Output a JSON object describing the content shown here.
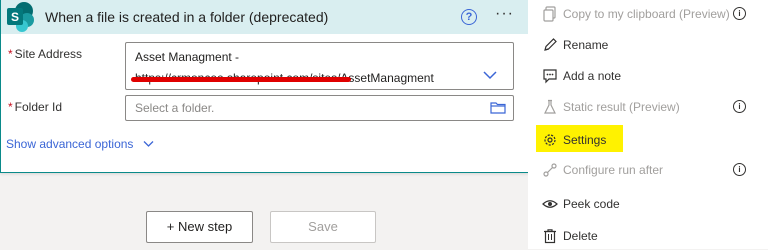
{
  "card": {
    "title": "When a file is created in a folder (deprecated)",
    "help_glyph": "?",
    "more_glyph": "···",
    "site_label": "Site Address",
    "required_mark": "*",
    "site_value_line1": "Asset Managment -",
    "site_value_line2": "https://crmoncee.sharepoint.com/sites/AssetManagment",
    "folder_label": "Folder Id",
    "folder_placeholder": "Select a folder.",
    "advanced_link": "Show advanced options",
    "logo_letter": "S"
  },
  "buttons": {
    "new_step": "+ New step",
    "save": "Save"
  },
  "menu": {
    "items": [
      {
        "label": "Copy to my clipboard (Preview)",
        "icon": "copy-icon",
        "disabled": true,
        "info": true
      },
      {
        "label": "Rename",
        "icon": "pencil-icon",
        "disabled": false,
        "info": false
      },
      {
        "label": "Add a note",
        "icon": "note-icon",
        "disabled": false,
        "info": false
      },
      {
        "label": "Static result (Preview)",
        "icon": "flask-icon",
        "disabled": true,
        "info": true
      },
      {
        "label": "Settings",
        "icon": "gear-icon",
        "disabled": false,
        "info": false,
        "highlighted": true
      },
      {
        "label": "Configure run after",
        "icon": "run-after-icon",
        "disabled": true,
        "info": true
      },
      {
        "label": "Peek code",
        "icon": "eye-icon",
        "disabled": false,
        "info": false
      },
      {
        "label": "Delete",
        "icon": "trash-icon",
        "disabled": false,
        "info": false
      }
    ],
    "info_glyph": "i"
  },
  "colors": {
    "header_bg": "#d9eef0",
    "accent": "#3b66d6",
    "highlight": "#fff200",
    "redaction": "#e00000",
    "sharepoint": "#036c70"
  }
}
